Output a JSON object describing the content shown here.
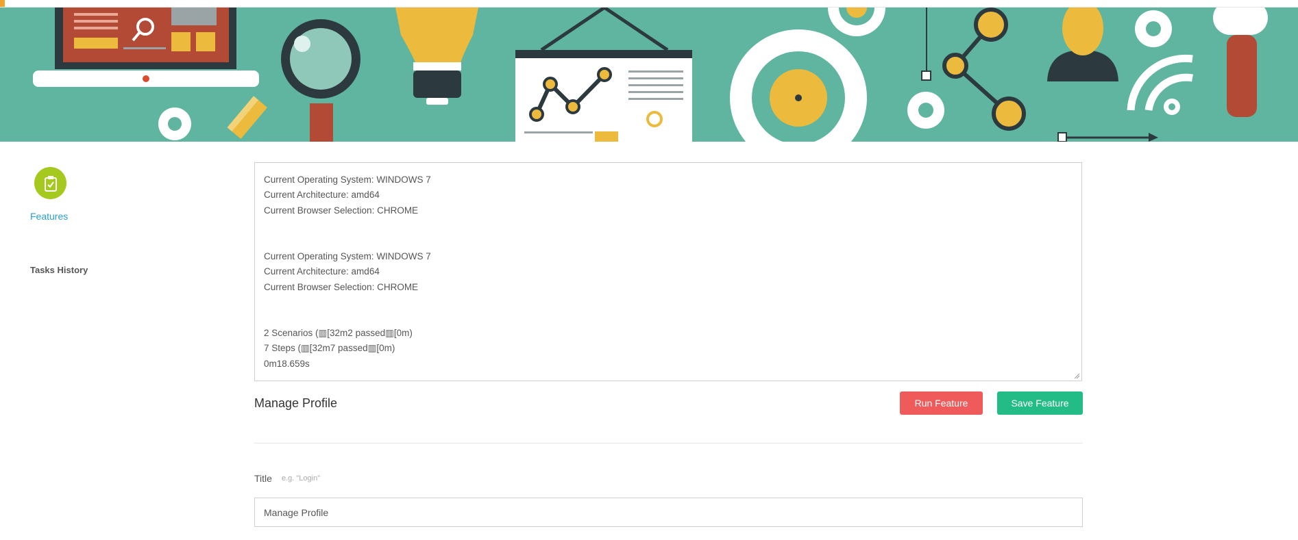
{
  "sidebar": {
    "features_label": "Features",
    "tasks_history_label": "Tasks History"
  },
  "console": {
    "lines": [
      "Current Operating System: WINDOWS 7",
      "Current Architecture: amd64",
      "Current Browser Selection: CHROME",
      "",
      "",
      "Current Operating System: WINDOWS 7",
      "Current Architecture: amd64",
      "Current Browser Selection: CHROME",
      "",
      "",
      "2 Scenarios (▥[32m2 passed▥[0m)",
      "7 Steps (▥[32m7 passed▥[0m)",
      "0m18.659s"
    ]
  },
  "profile": {
    "section_title": "Manage Profile",
    "run_button_label": "Run Feature",
    "save_button_label": "Save Feature",
    "title_field_label": "Title",
    "title_field_hint": "e.g. \"Login\"",
    "title_field_value": "Manage Profile"
  },
  "colors": {
    "banner_bg": "#5fb5a0",
    "feature_circle": "#a6c91f",
    "link_blue": "#2a9fd6",
    "run_red": "#ef5b5b",
    "save_green": "#23bc86",
    "accent_yellow": "#ecba3c",
    "accent_dark": "#2c3a3f",
    "accent_brick": "#b34a35"
  },
  "icons": {
    "feature_icon": "clipboard-check-icon"
  }
}
